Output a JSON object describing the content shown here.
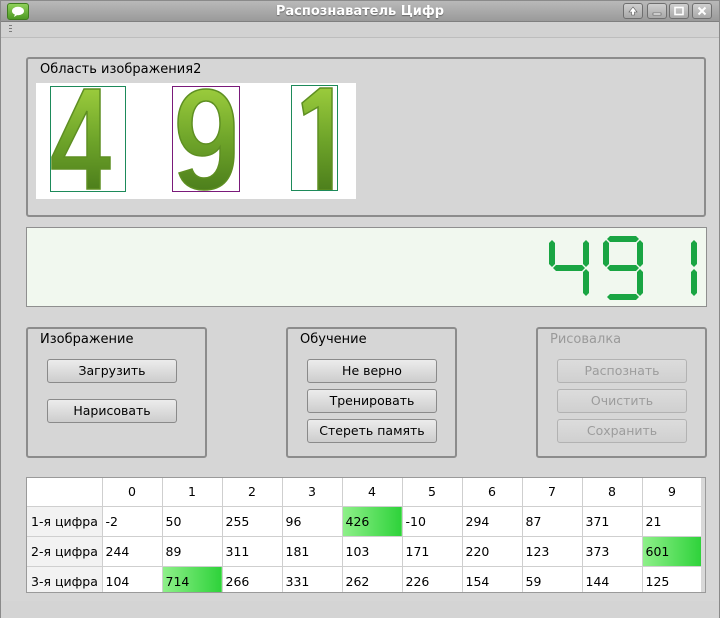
{
  "window": {
    "title": "Распознаватель Цифр"
  },
  "image_area": {
    "title": "Область изображения2",
    "digits": [
      "4",
      "9",
      "1"
    ]
  },
  "display": {
    "value": "491",
    "segment_color": "#1aa543"
  },
  "group_image": {
    "title": "Изображение",
    "load_label": "Загрузить",
    "draw_label": "Нарисовать"
  },
  "group_train": {
    "title": "Обучение",
    "wrong_label": "Не верно",
    "train_label": "Тренировать",
    "clear_memory_label": "Стереть память"
  },
  "group_draw": {
    "title": "Рисовалка",
    "recognize_label": "Распознать",
    "clear_label": "Очистить",
    "save_label": "Сохранить"
  },
  "table": {
    "columns": [
      "0",
      "1",
      "2",
      "3",
      "4",
      "5",
      "6",
      "7",
      "8",
      "9"
    ],
    "rows": [
      {
        "label": "1-я цифра",
        "values": [
          "-2",
          "50",
          "255",
          "96",
          "426",
          "-10",
          "294",
          "87",
          "371",
          "21"
        ],
        "highlight": 4
      },
      {
        "label": "2-я цифра",
        "values": [
          "244",
          "89",
          "311",
          "181",
          "103",
          "171",
          "220",
          "123",
          "373",
          "601"
        ],
        "highlight": 9
      },
      {
        "label": "3-я цифра",
        "values": [
          "104",
          "714",
          "266",
          "331",
          "262",
          "226",
          "154",
          "59",
          "144",
          "125"
        ],
        "highlight": 1
      }
    ],
    "highlight_color": "#39d446"
  }
}
